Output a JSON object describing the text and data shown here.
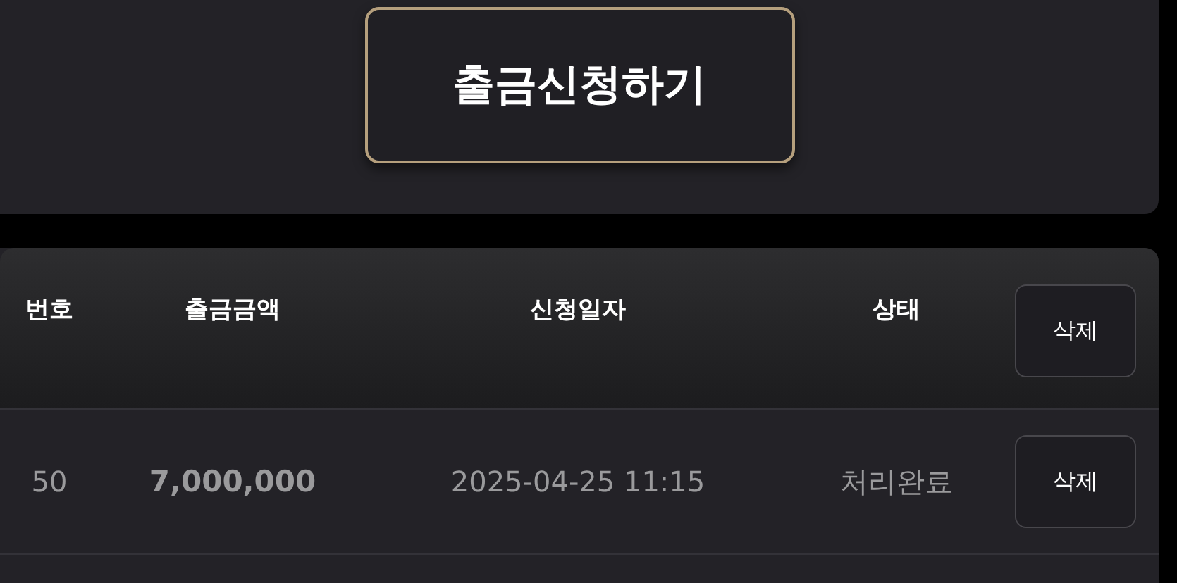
{
  "withdraw_button": "출금신청하기",
  "table": {
    "columns": [
      "번호",
      "출금금액",
      "신청일자",
      "상태"
    ],
    "header_button": "삭제",
    "rows": [
      {
        "number": "50",
        "amount": "7,000,000",
        "date": "2025-04-25 11:15",
        "status": "처리완료",
        "button": "삭제"
      }
    ]
  }
}
